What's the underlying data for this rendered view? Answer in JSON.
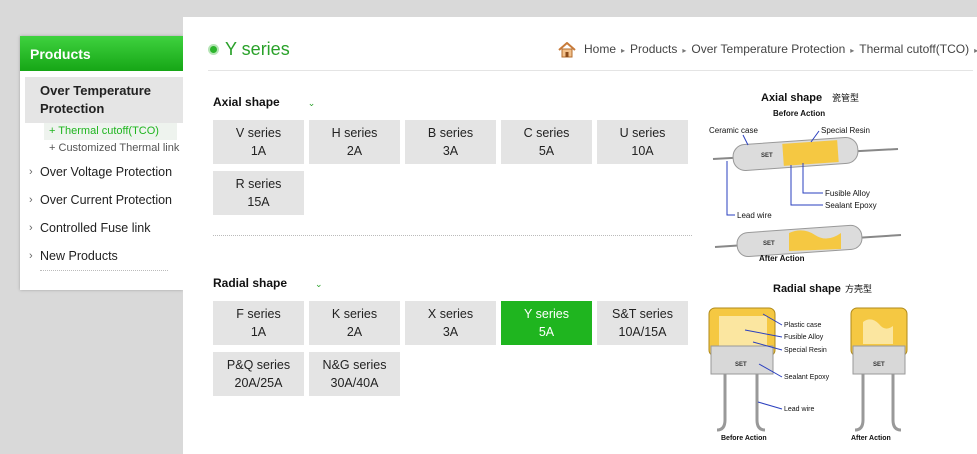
{
  "sidebar": {
    "title": "Products",
    "active_item": "Over Temperature Protection",
    "sub_items": [
      {
        "label": "Thermal cutoff(TCO)"
      },
      {
        "label": "Customized Thermal link"
      }
    ],
    "items": [
      {
        "label": "Over Voltage Protection"
      },
      {
        "label": "Over Current Protection"
      },
      {
        "label": "Controlled Fuse link"
      },
      {
        "label": "New Products"
      }
    ]
  },
  "page": {
    "title": "Y series",
    "breadcrumb": [
      "Home",
      "Products",
      "Over Temperature Protection",
      "Thermal cutoff(TCO)"
    ]
  },
  "axial": {
    "label": "Axial shape",
    "tiles": [
      {
        "name": "V series",
        "rating": "1A"
      },
      {
        "name": "H series",
        "rating": "2A"
      },
      {
        "name": "B series",
        "rating": "3A"
      },
      {
        "name": "C series",
        "rating": "5A"
      },
      {
        "name": "U series",
        "rating": "10A"
      },
      {
        "name": "R series",
        "rating": "15A"
      }
    ]
  },
  "radial": {
    "label": "Radial shape",
    "tiles": [
      {
        "name": "F series",
        "rating": "1A"
      },
      {
        "name": "K series",
        "rating": "2A"
      },
      {
        "name": "X series",
        "rating": "3A"
      },
      {
        "name": "Y series",
        "rating": "5A",
        "selected": true
      },
      {
        "name": "S&T series",
        "rating": "10A/15A"
      },
      {
        "name": "P&Q series",
        "rating": "20A/25A"
      },
      {
        "name": "N&G series",
        "rating": "30A/40A"
      }
    ]
  },
  "axial_diagram": {
    "title": "Axial  shape",
    "title_cn": "瓷管型",
    "before": "Before Action",
    "after": "After Action",
    "labels": [
      "Ceramic case",
      "Special Resin",
      "Fusible Alloy",
      "Sealant Epoxy",
      "Lead wire"
    ],
    "marking": "SET"
  },
  "radial_diagram": {
    "title": "Radial  shape",
    "title_cn": "方壳型",
    "before": "Before Action",
    "after": "After Action",
    "labels": [
      "Plastic case",
      "Fusible Alloy",
      "Special Resin",
      "Sealant Epoxy",
      "Lead wire"
    ],
    "marking": "SET"
  },
  "colors": {
    "accent": "#1fb51f",
    "tile": "#e4e4e4",
    "resin": "#f5c842"
  }
}
